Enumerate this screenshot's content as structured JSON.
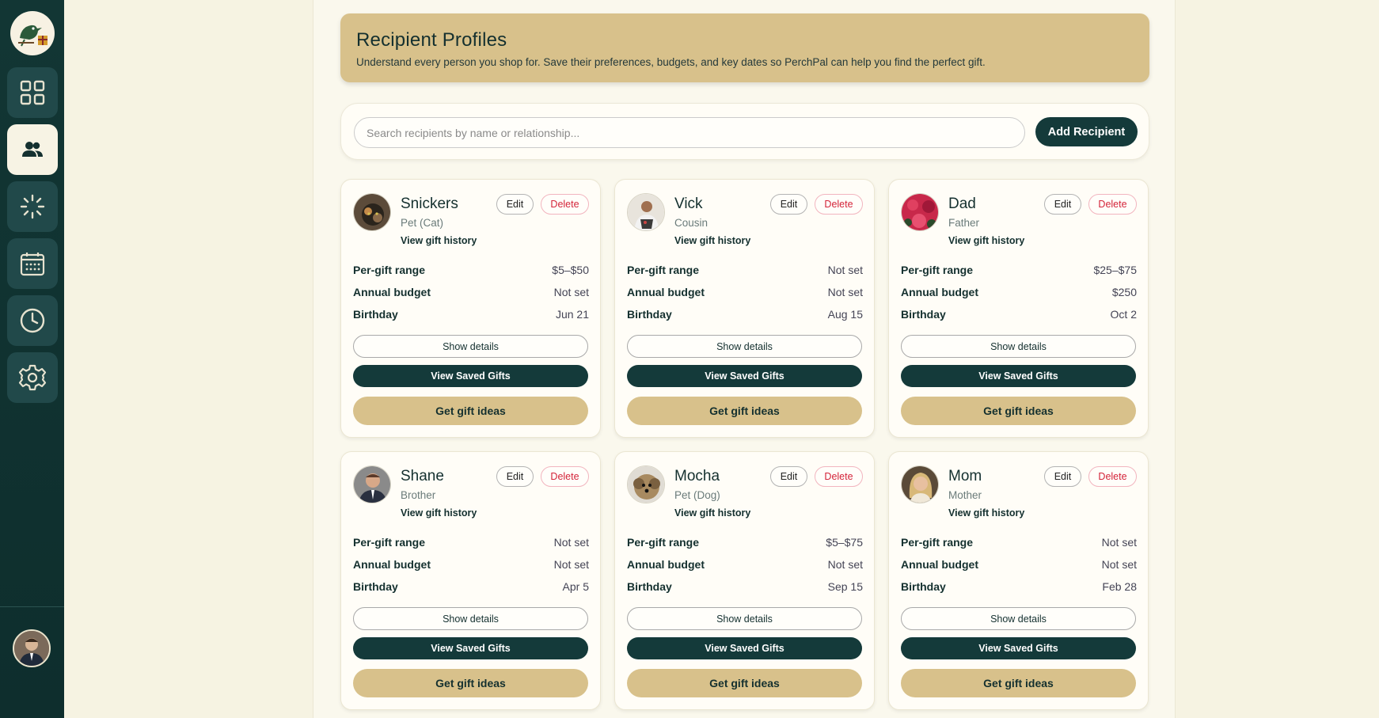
{
  "app": {
    "name": "PerchPal",
    "accent": "#143a3a",
    "gold": "#d8c18b"
  },
  "sidebar": {
    "logo_icon": "bird-with-gift-logo",
    "items": [
      {
        "name": "dashboard",
        "icon": "grid-icon",
        "active": false
      },
      {
        "name": "recipients",
        "icon": "people-icon",
        "active": true
      },
      {
        "name": "ideas",
        "icon": "spark-icon",
        "active": false
      },
      {
        "name": "calendar",
        "icon": "calendar-icon",
        "active": false
      },
      {
        "name": "history",
        "icon": "clock-icon",
        "active": false
      },
      {
        "name": "settings",
        "icon": "gear-icon",
        "active": false
      }
    ],
    "user_avatar": "user-avatar"
  },
  "header": {
    "title": "Recipient Profiles",
    "subtitle": "Understand every person you shop for. Save their preferences, budgets, and key dates so PerchPal can help you find the perfect gift."
  },
  "search": {
    "placeholder": "Search recipients by name or relationship...",
    "add_label": "Add Recipient"
  },
  "card_labels": {
    "edit": "Edit",
    "delete": "Delete",
    "history": "View gift history",
    "per_gift": "Per-gift range",
    "annual": "Annual budget",
    "birthday": "Birthday",
    "details": "Show details",
    "saved": "View Saved Gifts",
    "ideas": "Get gift ideas"
  },
  "recipients": [
    {
      "name": "Snickers",
      "relationship": "Pet (Cat)",
      "per_gift": "$5–$50",
      "annual": "Not set",
      "birthday": "Jun 21"
    },
    {
      "name": "Vick",
      "relationship": "Cousin",
      "per_gift": "Not set",
      "annual": "Not set",
      "birthday": "Aug 15"
    },
    {
      "name": "Dad",
      "relationship": "Father",
      "per_gift": "$25–$75",
      "annual": "$250",
      "birthday": "Oct 2"
    },
    {
      "name": "Shane",
      "relationship": "Brother",
      "per_gift": "Not set",
      "annual": "Not set",
      "birthday": "Apr 5"
    },
    {
      "name": "Mocha",
      "relationship": "Pet (Dog)",
      "per_gift": "$5–$75",
      "annual": "Not set",
      "birthday": "Sep 15"
    },
    {
      "name": "Mom",
      "relationship": "Mother",
      "per_gift": "Not set",
      "annual": "Not set",
      "birthday": "Feb 28"
    }
  ]
}
